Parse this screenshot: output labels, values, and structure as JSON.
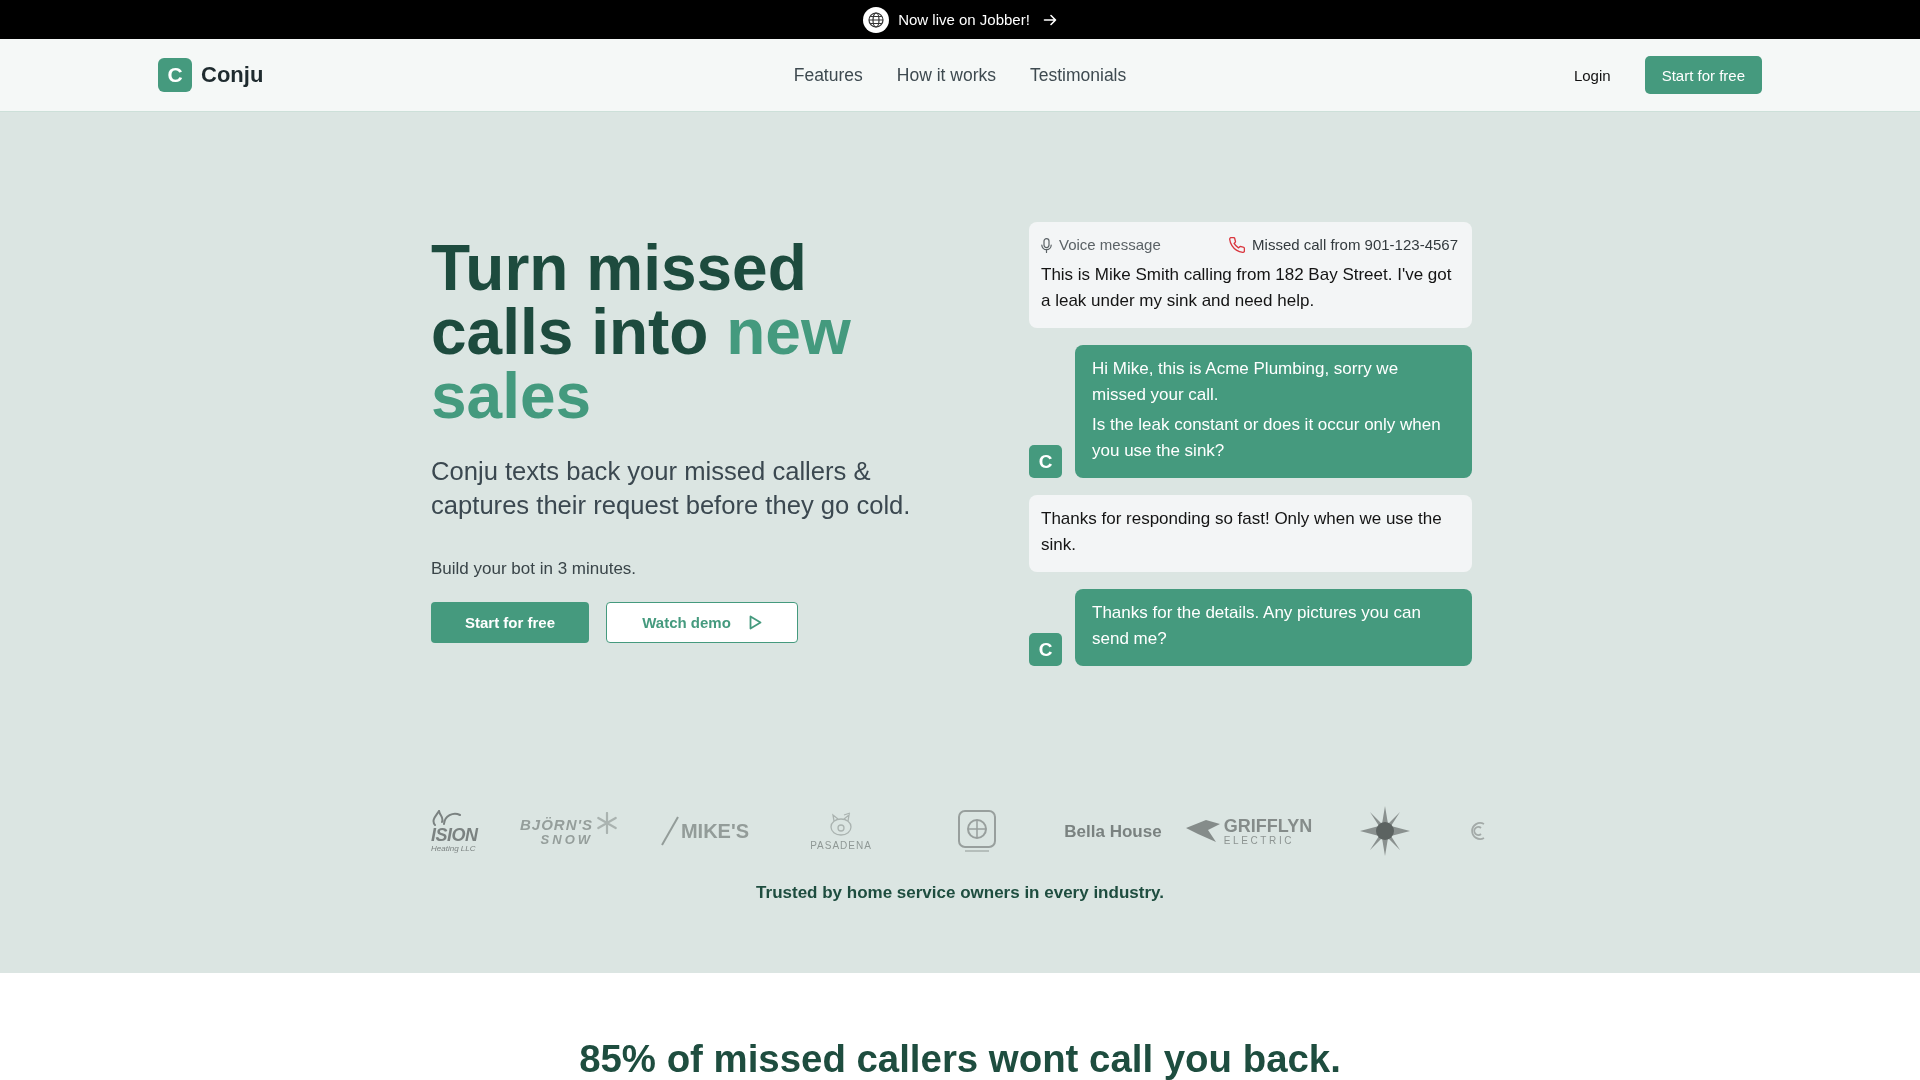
{
  "announcement": {
    "text": "Now live on Jobber!"
  },
  "nav": {
    "brand_mark": "C",
    "brand_name": "Conju",
    "links": [
      "Features",
      "How it works",
      "Testimonials"
    ],
    "login": "Login",
    "cta": "Start for free"
  },
  "hero": {
    "headline": {
      "lead": "Turn missed calls into",
      "highlight": "new sales"
    },
    "subtitle": "Conju texts back your missed callers & captures their request before they go cold.",
    "note": "Build your bot in 3 minutes.",
    "buttons": [
      {
        "label": "Start for free",
        "kind": "primary"
      },
      {
        "label": "Watch demo",
        "kind": "outline"
      }
    ]
  },
  "chat": {
    "messages": [
      {
        "kind": "voicemail",
        "label": "Voice message",
        "caller": "Missed call from 901-123-4567",
        "paragraphs": [
          "This is Mike Smith calling from 182 Bay Street. I've got a leak under my sink and need help."
        ]
      },
      {
        "kind": "reply",
        "avatar": "C",
        "paragraphs": [
          "Hi Mike, this is Acme Plumbing, sorry we missed your call.",
          "Is the leak constant or does it occur only when you use the sink?"
        ]
      },
      {
        "kind": "customer",
        "paragraphs": [
          "Thanks for responding so fast! Only when we use the sink."
        ]
      },
      {
        "kind": "reply",
        "avatar": "C",
        "paragraphs": [
          "Thanks for the details. Any pictures you can send me?"
        ]
      }
    ]
  },
  "logos": {
    "items": [
      {
        "kind": "flame",
        "lines": [
          "ISION",
          "Heating LLC"
        ]
      },
      {
        "kind": "snowflake",
        "lines": [
          "BJÖRN'S",
          "SNOW"
        ]
      },
      {
        "kind": "slash",
        "lines": [
          "MIKE'S"
        ]
      },
      {
        "kind": "pig",
        "lines": [
          "PASADENA"
        ]
      },
      {
        "kind": "emblem"
      },
      {
        "kind": "wordmark",
        "lines": [
          "Bella House"
        ]
      },
      {
        "kind": "bird",
        "lines": [
          "GRIFFLYN",
          "ELECTRIC"
        ]
      },
      {
        "kind": "sun"
      },
      {
        "kind": "ring"
      }
    ],
    "caption": "Trusted by home service owners in every industry."
  },
  "stats": {
    "heading": "85% of missed callers wont call you back."
  }
}
